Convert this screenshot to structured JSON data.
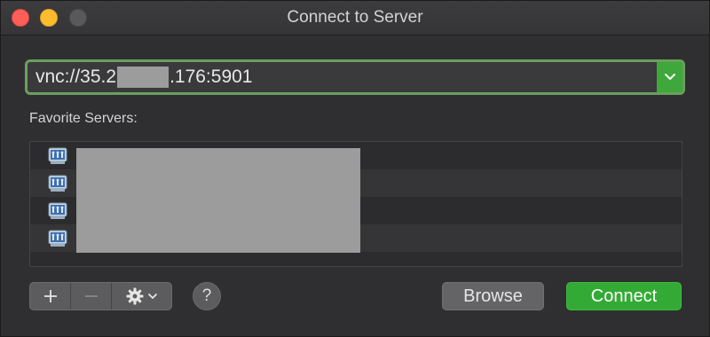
{
  "window": {
    "title": "Connect to Server"
  },
  "address": {
    "value_prefix": "vnc://35.2",
    "value_suffix": ".176:5901"
  },
  "favorites": {
    "label": "Favorite Servers:",
    "rows": 4
  },
  "toolbar": {
    "add_label": "+",
    "remove_label": "−",
    "help_label": "?",
    "browse_label": "Browse",
    "connect_label": "Connect"
  },
  "colors": {
    "accent": "#33aa35",
    "focus_ring": "#6a9f5f"
  }
}
